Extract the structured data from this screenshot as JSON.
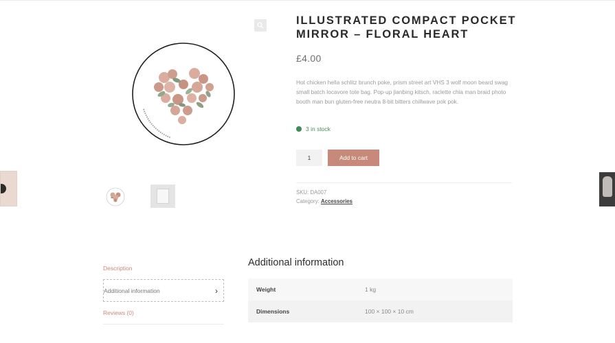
{
  "product": {
    "title": "ILLUSTRATED COMPACT POCKET MIRROR – FLORAL HEART",
    "price": "£4.00",
    "description": "Hot chicken hella schlitz brunch poke, prism street art VHS 3 wolf moon beard swag small batch locavore tote bag. Pop-up jianbing kitsch, raclette chia man braid photo booth man bun gluten-free neutra 8-bit bitters chillwave pok pok.",
    "stock": "3 in stock",
    "quantity": "1",
    "add_to_cart": "Add to cart",
    "sku_label": "SKU:",
    "sku": "DA007",
    "category_label": "Category:",
    "category": "Accessories"
  },
  "tabs": {
    "description": "Description",
    "additional": "Additional information",
    "reviews": "Reviews (0)",
    "chevron": "›"
  },
  "additional": {
    "title": "Additional information",
    "rows": [
      {
        "key": "Weight",
        "value": "1 kg"
      },
      {
        "key": "Dimensions",
        "value": "100 × 100 × 10 cm"
      }
    ]
  },
  "icons": {
    "zoom": "magnifier-icon",
    "stock": "check-circle-icon"
  },
  "colors": {
    "accent": "#c6897a",
    "in_stock": "#3f8a55"
  }
}
